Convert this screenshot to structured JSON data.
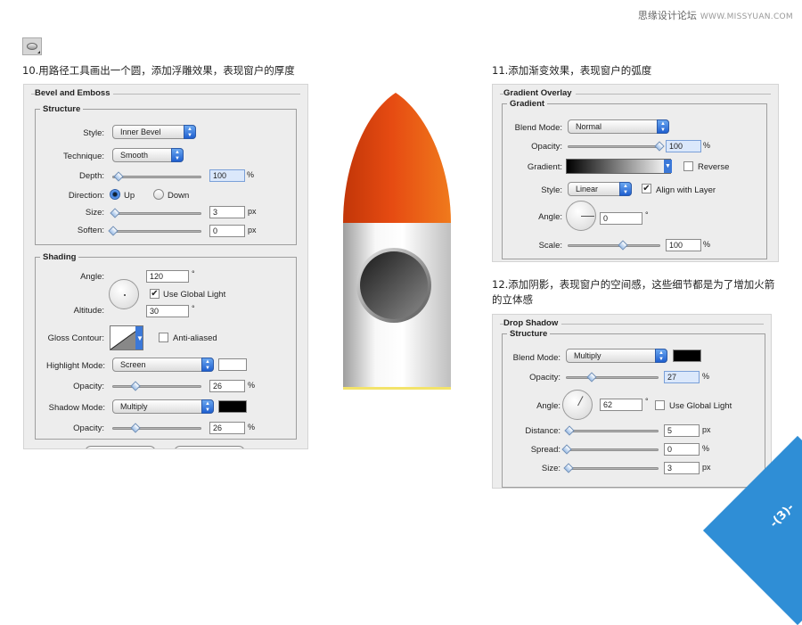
{
  "watermark": {
    "text": "思缘设计论坛",
    "site": "WWW.MISSYUAN.COM"
  },
  "step10": {
    "caption": "10.用路径工具画出一个圆，添加浮雕效果，表现窗户的厚度",
    "panel_title": "Bevel and Emboss",
    "structure": {
      "legend": "Structure",
      "style_label": "Style:",
      "style_value": "Inner Bevel",
      "technique_label": "Technique:",
      "technique_value": "Smooth",
      "depth_label": "Depth:",
      "depth_value": "100",
      "depth_unit": "%",
      "direction_label": "Direction:",
      "direction_up": "Up",
      "direction_down": "Down",
      "size_label": "Size:",
      "size_value": "3",
      "size_unit": "px",
      "soften_label": "Soften:",
      "soften_value": "0",
      "soften_unit": "px"
    },
    "shading": {
      "legend": "Shading",
      "angle_label": "Angle:",
      "angle_value": "120",
      "angle_unit": "°",
      "global_light": "Use Global Light",
      "altitude_label": "Altitude:",
      "altitude_value": "30",
      "altitude_unit": "°",
      "gloss_label": "Gloss Contour:",
      "anti_aliased": "Anti-aliased",
      "highlight_label": "Highlight Mode:",
      "highlight_value": "Screen",
      "opacity1_label": "Opacity:",
      "opacity1_value": "26",
      "opacity1_unit": "%",
      "shadow_label": "Shadow Mode:",
      "shadow_value": "Multiply",
      "opacity2_label": "Opacity:",
      "opacity2_value": "26",
      "opacity2_unit": "%"
    }
  },
  "step11": {
    "caption": "11.添加渐变效果，表现窗户的弧度",
    "panel_title": "Gradient Overlay",
    "legend": "Gradient",
    "blend_label": "Blend Mode:",
    "blend_value": "Normal",
    "opacity_label": "Opacity:",
    "opacity_value": "100",
    "opacity_unit": "%",
    "gradient_label": "Gradient:",
    "reverse": "Reverse",
    "style_label": "Style:",
    "style_value": "Linear",
    "align": "Align with Layer",
    "angle_label": "Angle:",
    "angle_value": "0",
    "angle_unit": "°",
    "scale_label": "Scale:",
    "scale_value": "100",
    "scale_unit": "%"
  },
  "step12": {
    "caption": "12.添加阴影，表现窗户的空间感，这些细节都是为了增加火箭的立体感",
    "panel_title": "Drop Shadow",
    "legend": "Structure",
    "blend_label": "Blend Mode:",
    "blend_value": "Multiply",
    "opacity_label": "Opacity:",
    "opacity_value": "27",
    "opacity_unit": "%",
    "angle_label": "Angle:",
    "angle_value": "62",
    "angle_unit": "°",
    "global_light": "Use Global Light",
    "distance_label": "Distance:",
    "distance_value": "5",
    "distance_unit": "px",
    "spread_label": "Spread:",
    "spread_value": "0",
    "spread_unit": "%",
    "size_label": "Size:",
    "size_value": "3",
    "size_unit": "px"
  },
  "page_number": "-(3)-",
  "colors": {
    "accent": "#2f8ed6",
    "rocket_nose": "#e8521a",
    "rocket_body": "#d8d8d8"
  }
}
